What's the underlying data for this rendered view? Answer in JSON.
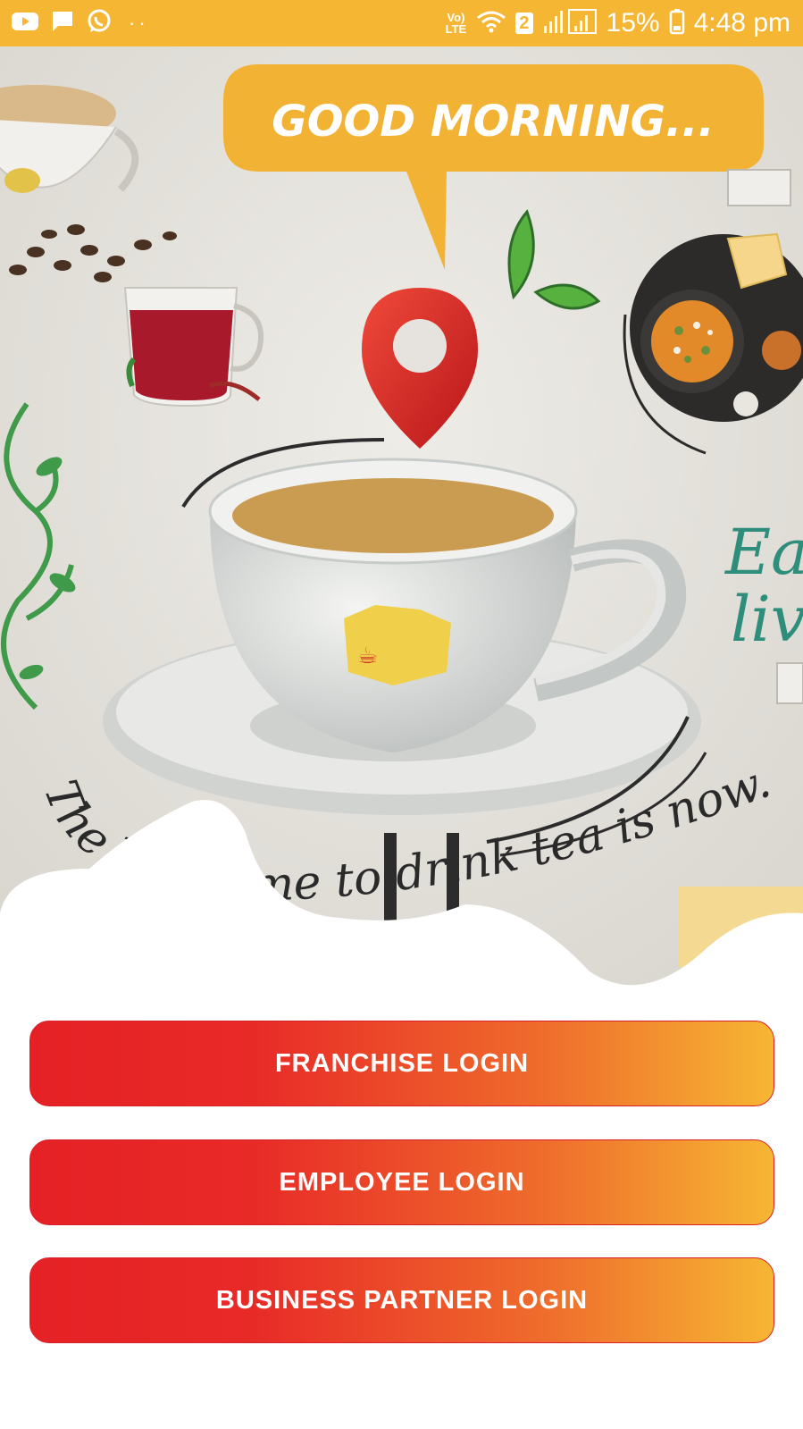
{
  "status_bar": {
    "lte_label": "Vo) LTE",
    "sim_badge": "2",
    "battery_percent": "15%",
    "time": "4:48 pm",
    "icons": [
      "youtube-icon",
      "message-icon",
      "whatsapp-icon",
      "more-dots-icon",
      "wifi-icon",
      "signal-icon",
      "battery-icon"
    ],
    "color": "#f5b733"
  },
  "hero": {
    "speech_bubble_text": "GOOD MORNING...",
    "tagline": "The best time to drink tea is now.",
    "wall_text_1": "Eat",
    "wall_text_2": "live"
  },
  "buttons": {
    "franchise_login": "FRANCHISE LOGIN",
    "employee_login": "EMPLOYEE LOGIN",
    "business_partner_login": "BUSINESS PARTNER LOGIN",
    "gradient_start": "#e52125",
    "gradient_end": "#f6b633"
  }
}
